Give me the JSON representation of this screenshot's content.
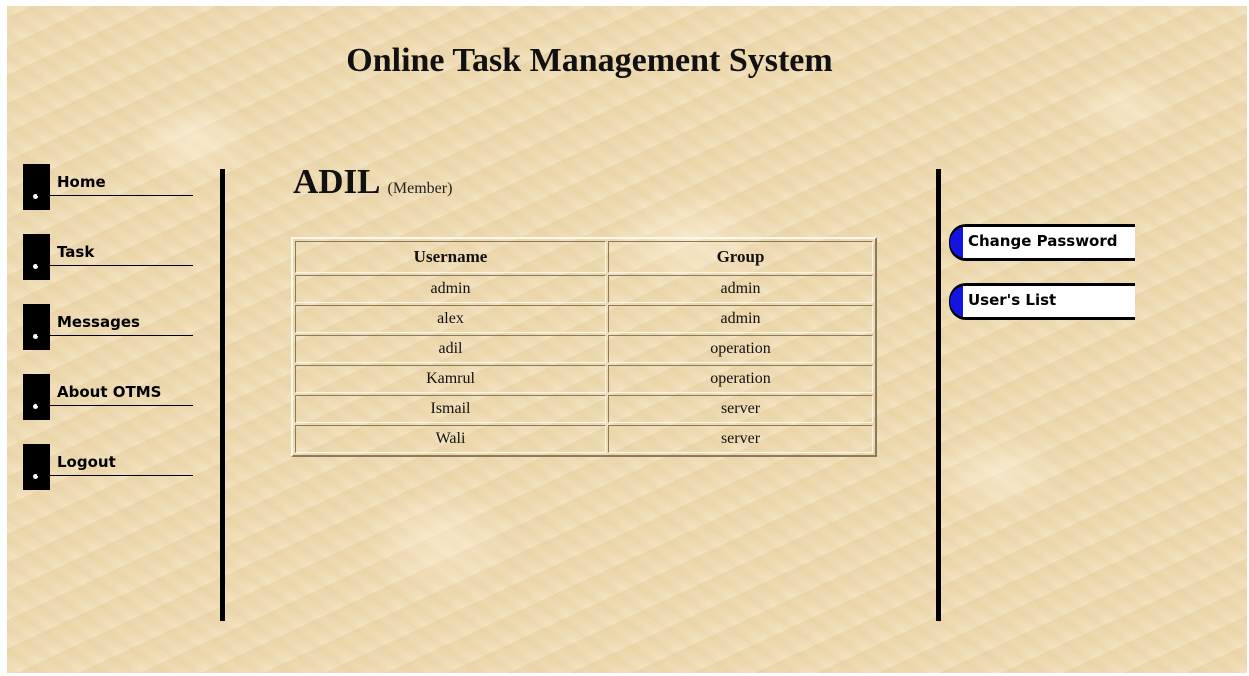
{
  "header": {
    "title": "Online Task Management System"
  },
  "nav": {
    "items": [
      {
        "label": "Home"
      },
      {
        "label": "Task"
      },
      {
        "label": "Messages"
      },
      {
        "label": "About OTMS"
      },
      {
        "label": "Logout"
      }
    ]
  },
  "user": {
    "name": "ADIL",
    "role": "(Member)"
  },
  "table": {
    "columns": [
      "Username",
      "Group"
    ],
    "rows": [
      [
        "admin",
        "admin"
      ],
      [
        "alex",
        "admin"
      ],
      [
        "adil",
        "operation"
      ],
      [
        "Kamrul",
        "operation"
      ],
      [
        "Ismail",
        "server"
      ],
      [
        "Wali",
        "server"
      ]
    ]
  },
  "right_menu": {
    "items": [
      {
        "label": "Change Password"
      },
      {
        "label": "User's List"
      }
    ]
  },
  "colors": {
    "background": "#efdcb4",
    "accent_blue": "#1414e0",
    "text": "#111111"
  }
}
